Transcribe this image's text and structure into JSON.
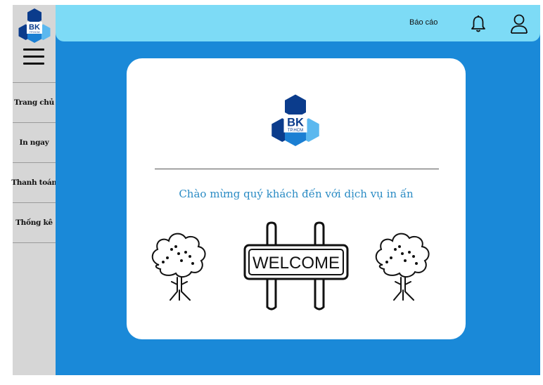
{
  "brand": {
    "logo_text": "BK",
    "logo_sub": "TP.HCM"
  },
  "sidebar": {
    "items": [
      {
        "label": "Trang chủ"
      },
      {
        "label": "In ngay"
      },
      {
        "label": "Thanh toán"
      },
      {
        "label": "Thống kê"
      }
    ]
  },
  "header": {
    "report_label": "Báo cáo",
    "notification_icon": "bell-icon",
    "profile_icon": "user-icon"
  },
  "main": {
    "welcome_message": "Chào mừng quý khách đến với dịch vụ in ấn",
    "sign_text": "WELCOME"
  },
  "colors": {
    "background": "#1a89d8",
    "topbar": "#7ddbf6",
    "sidebar": "#d6d6d6",
    "welcome_text": "#2a8bc4",
    "logo_dark": "#0b3c8c",
    "logo_mid": "#1b7fd3",
    "logo_light": "#5bb8ef"
  }
}
